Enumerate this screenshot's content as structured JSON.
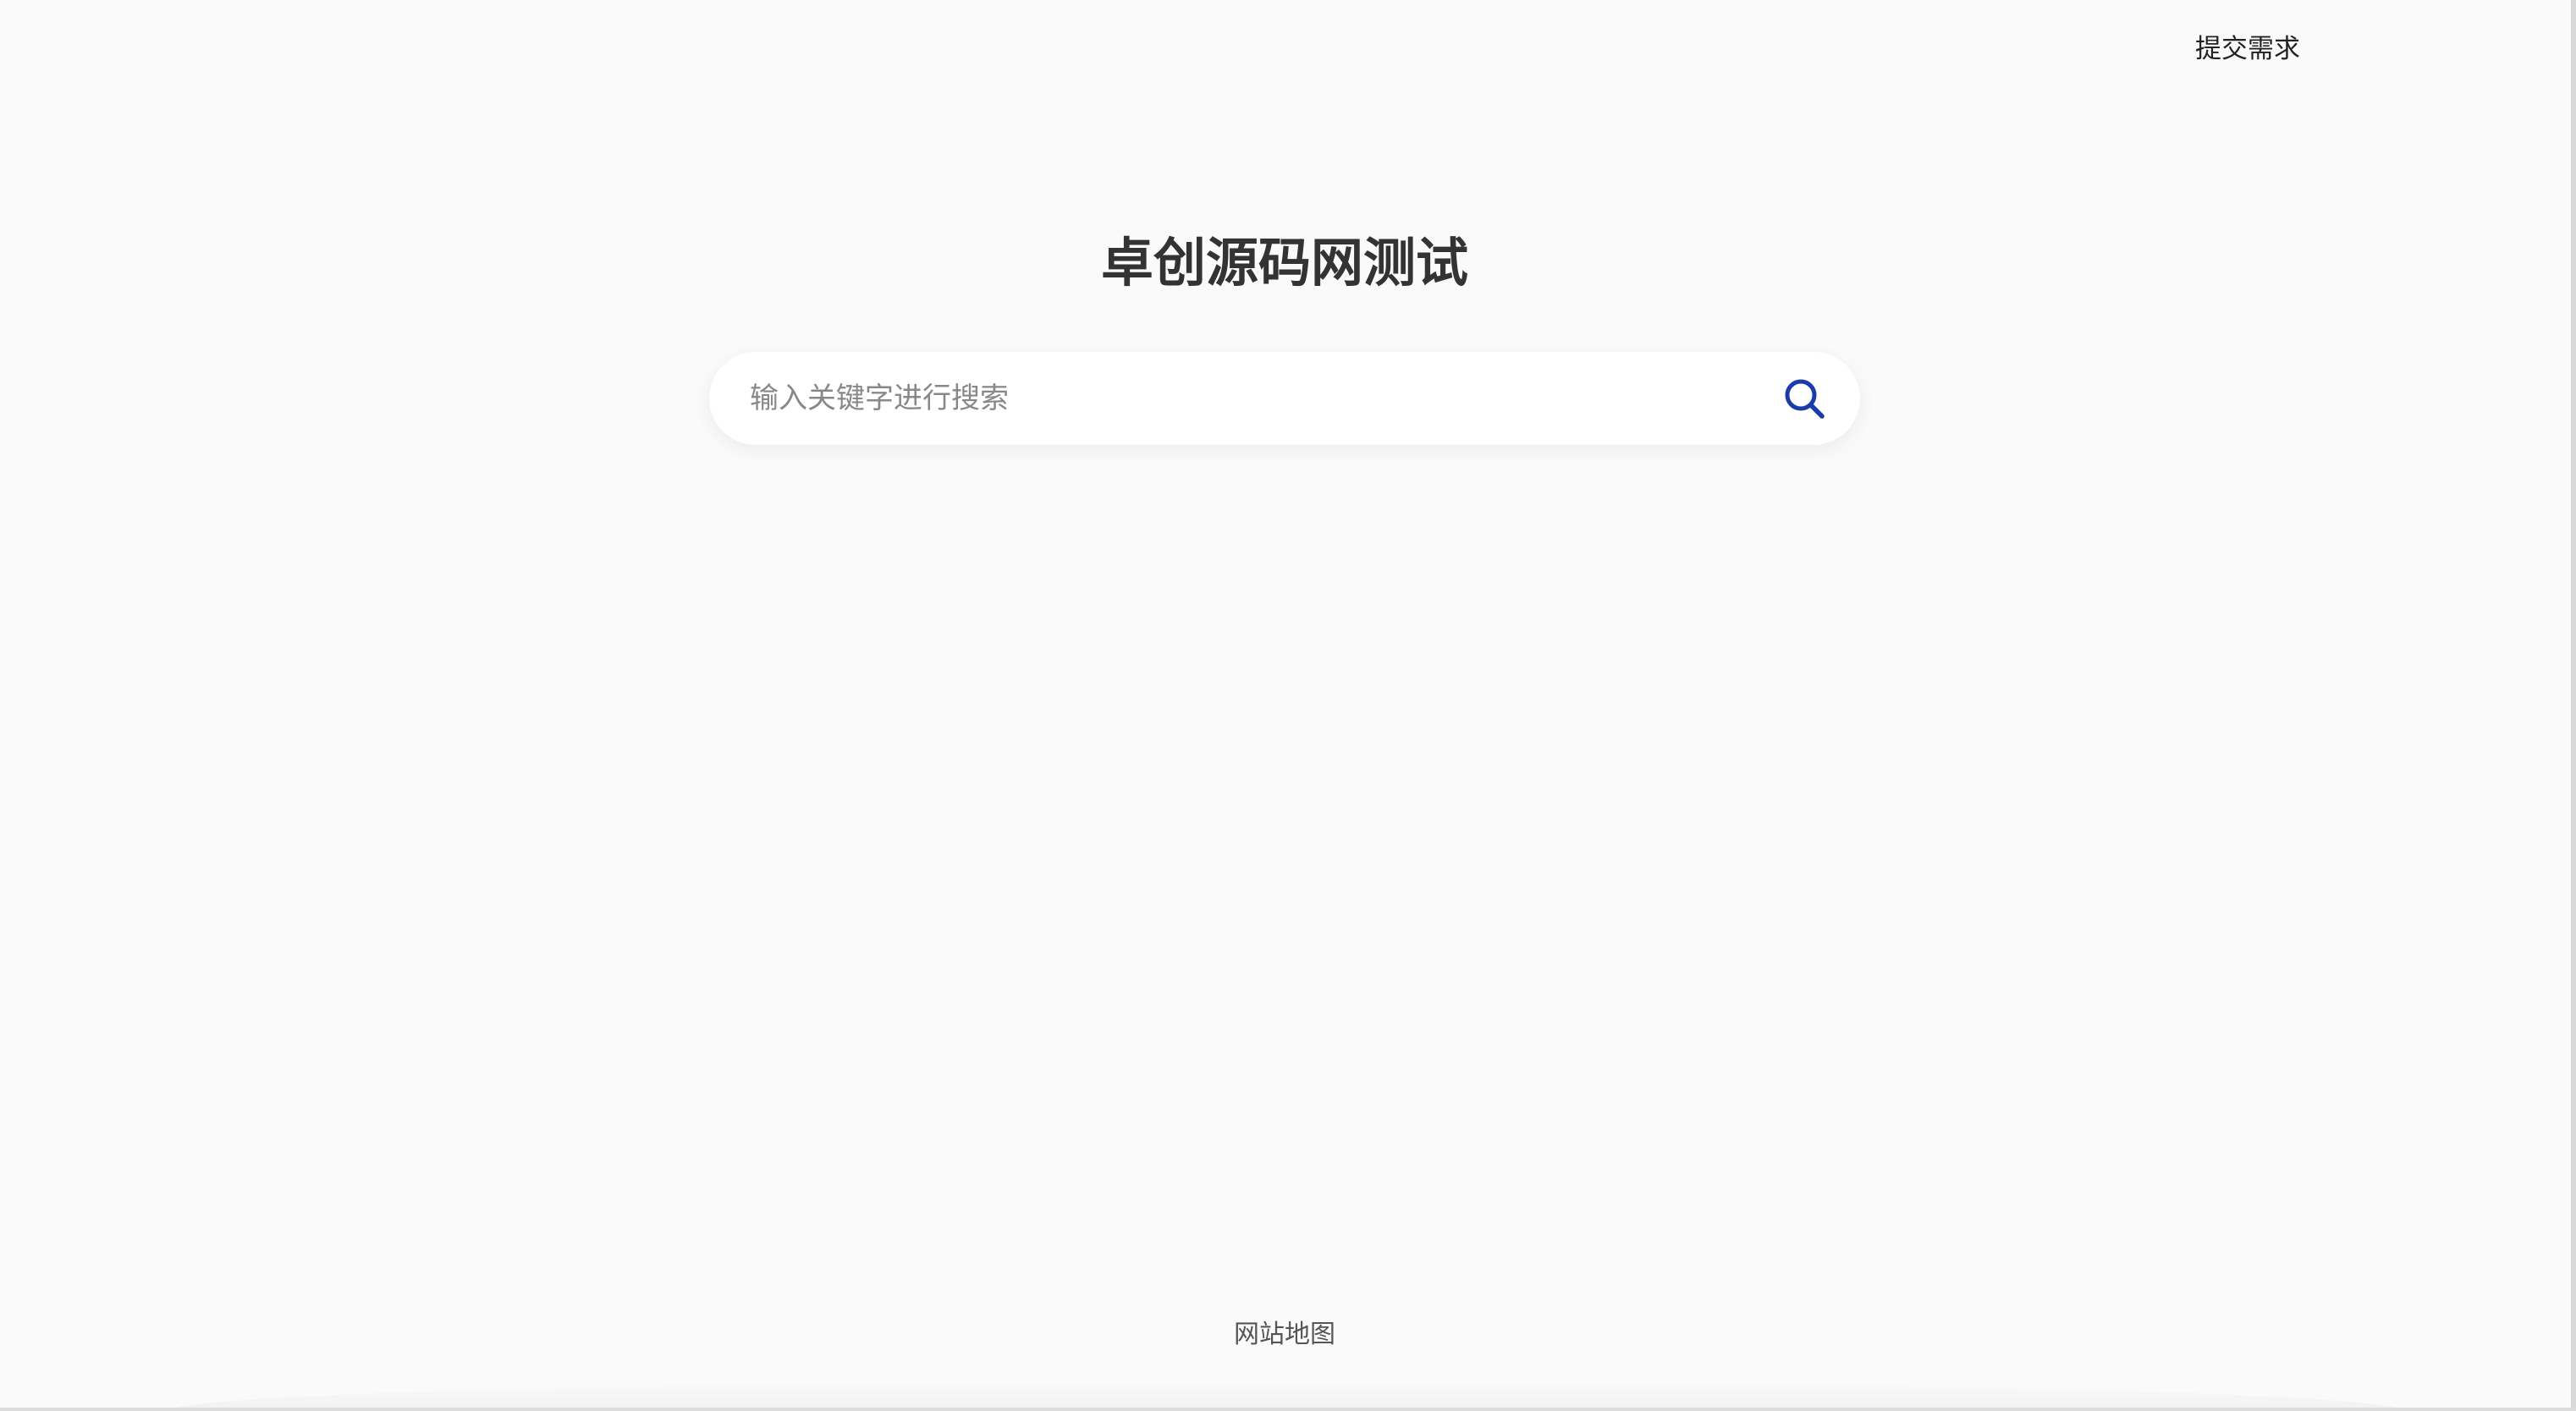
{
  "header": {
    "submit_request_label": "提交需求"
  },
  "main": {
    "site_title": "卓创源码网测试",
    "search": {
      "placeholder": "输入关键字进行搜索",
      "value": "",
      "icon": "search-icon",
      "icon_color": "#1a3caa"
    }
  },
  "footer": {
    "sitemap_label": "网站地图"
  },
  "colors": {
    "background": "#fafafa",
    "title": "#333333",
    "accent": "#1a3caa"
  }
}
